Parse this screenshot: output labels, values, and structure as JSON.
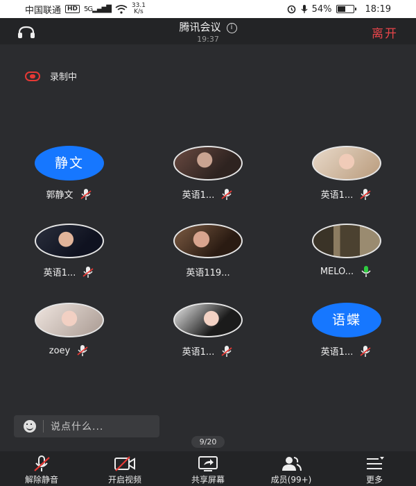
{
  "status_bar": {
    "carrier": "中国联通",
    "hd": "HD",
    "network": "5G",
    "speed_value": "33.1",
    "speed_unit": "K/s",
    "battery": "54%",
    "battery_level": 0.54,
    "time": "18:19"
  },
  "header": {
    "title": "腾讯会议",
    "timer": "19:37",
    "leave": "离开"
  },
  "recording": {
    "label": "录制中",
    "color": "#e53935"
  },
  "participants": [
    {
      "avatar_text": "静文",
      "name": "郭静文"
    },
    {
      "avatar_text": "",
      "name": "英语1..."
    },
    {
      "avatar_text": "",
      "name": "英语1..."
    },
    {
      "avatar_text": "",
      "name": "英语1..."
    },
    {
      "avatar_text": "",
      "name": "英语119..."
    },
    {
      "avatar_text": "",
      "name": "MELO..."
    },
    {
      "avatar_text": "",
      "name": "zoey"
    },
    {
      "avatar_text": "",
      "name": "英语1..."
    },
    {
      "avatar_text": "语蝶",
      "name": "英语1..."
    }
  ],
  "chat": {
    "placeholder": "说点什么..."
  },
  "pagination": "9/20",
  "toolbar": [
    {
      "label": "解除静音",
      "icon": "muted-mic-icon"
    },
    {
      "label": "开启视频",
      "icon": "video-off-icon"
    },
    {
      "label": "共享屏幕",
      "icon": "share-screen-icon"
    },
    {
      "label": "成员(99+)",
      "icon": "members-icon"
    },
    {
      "label": "更多",
      "icon": "more-menu-icon"
    }
  ],
  "colors": {
    "accent_blue": "#1677ff",
    "leave_red": "#e8454a",
    "active_mic_green": "#2ecc40"
  }
}
